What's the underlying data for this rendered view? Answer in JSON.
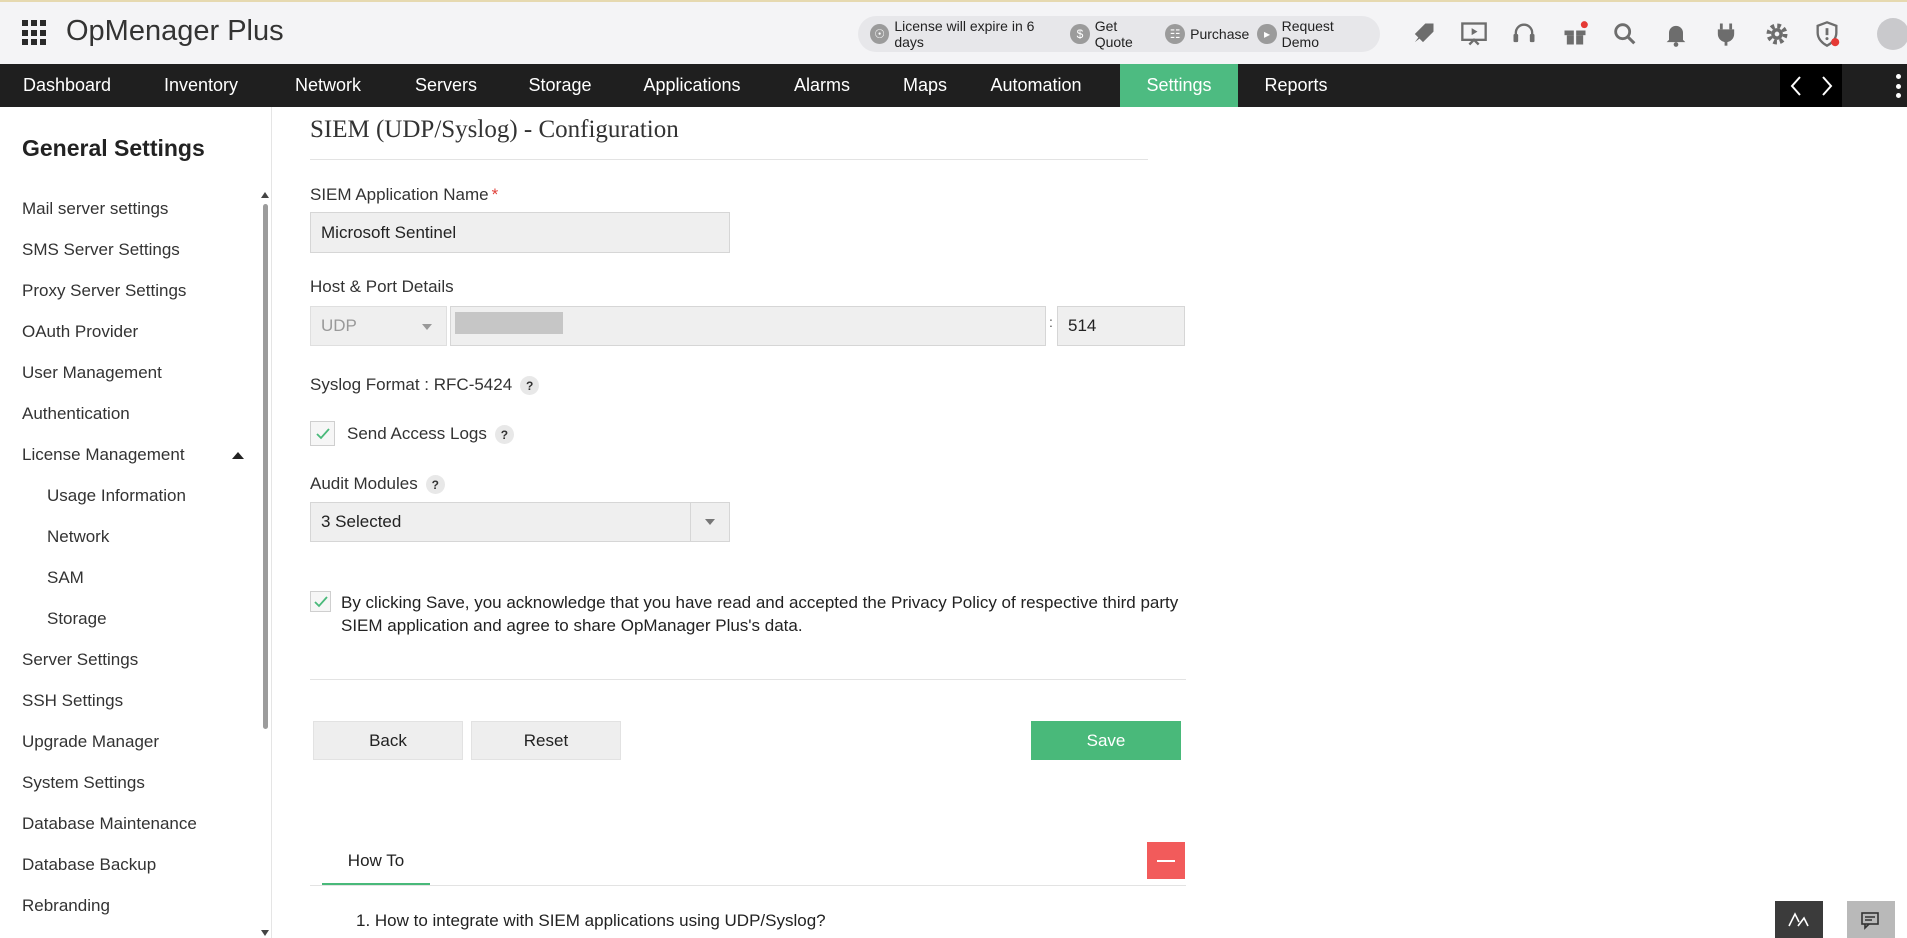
{
  "app": {
    "title": "OpMenager Plus"
  },
  "header": {
    "license_text": "License will expire in 6 days",
    "get_quote": "Get Quote",
    "purchase": "Purchase",
    "request_demo": "Request Demo",
    "icons": [
      "rocket-icon",
      "presentation-icon",
      "headset-icon",
      "gift-icon",
      "search-icon",
      "bell-icon",
      "plug-icon",
      "gear-icon",
      "alert-shield-icon"
    ]
  },
  "nav": {
    "items": [
      "Dashboard",
      "Inventory",
      "Network",
      "Servers",
      "Storage",
      "Applications",
      "Alarms",
      "Maps",
      "Automation",
      "Settings",
      "Reports"
    ],
    "active": "Settings",
    "active_color": "#4dbb81"
  },
  "sidebar": {
    "title": "General Settings",
    "items": [
      "Mail server settings",
      "SMS Server Settings",
      "Proxy Server Settings",
      "OAuth Provider",
      "User Management",
      "Authentication",
      "License Management",
      "Usage Information",
      "Network",
      "SAM",
      "Storage",
      "Server Settings",
      "SSH Settings",
      "Upgrade Manager",
      "System Settings",
      "Database Maintenance",
      "Database Backup",
      "Rebranding"
    ]
  },
  "form": {
    "title": "SIEM (UDP/Syslog) - Configuration",
    "app_name_label": "SIEM Application Name",
    "app_name_required": "*",
    "app_name_value": "Microsoft Sentinel",
    "host_port_label": "Host & Port Details",
    "protocol_value": "UDP",
    "port_value": "514",
    "syslog_format": "Syslog Format : RFC-5424",
    "send_access_logs_label": "Send Access Logs",
    "send_access_logs_checked": true,
    "audit_modules_label": "Audit Modules",
    "audit_modules_value": "3 Selected",
    "consent_text": "By clicking Save, you acknowledge that you have read and accepted the Privacy Policy of respective third party SIEM application and agree to share OpManager Plus's data.",
    "consent_checked": true,
    "help_glyph": "?",
    "back_label": "Back",
    "reset_label": "Reset",
    "save_label": "Save",
    "save_color": "#49b97a"
  },
  "howto": {
    "tab_label": "How To",
    "item": "1. How to integrate with SIEM applications using UDP/Syslog?"
  }
}
